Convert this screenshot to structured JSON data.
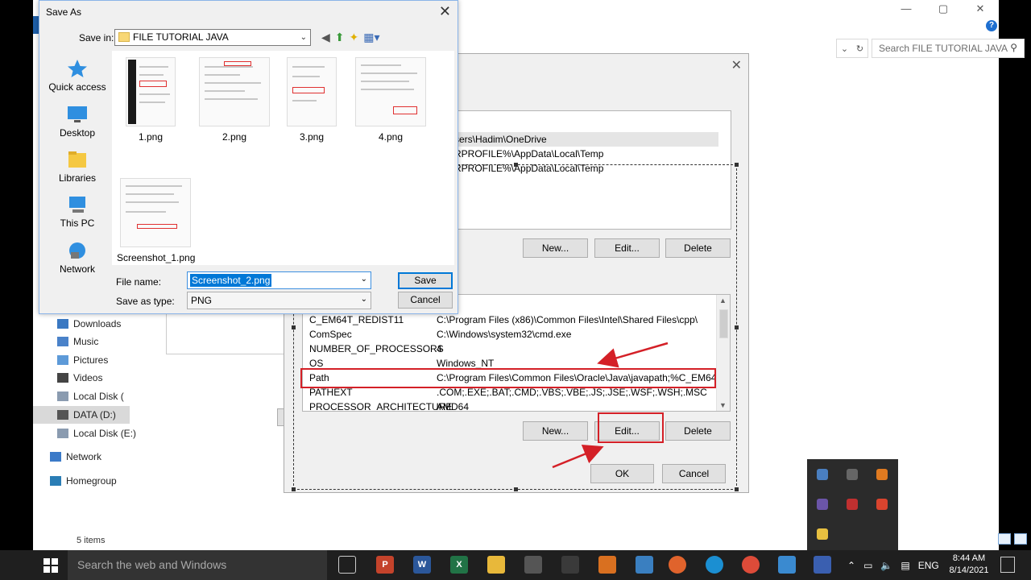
{
  "explorer": {
    "window_controls": [
      "—",
      "▢",
      "✕"
    ],
    "search_placeholder": "Search FILE TUTORIAL JAVA",
    "nav_items": [
      "Downloads",
      "Music",
      "Pictures",
      "Videos",
      "Local Disk (",
      "DATA (D:)",
      "Local Disk (E:)",
      "Network",
      "Homegroup"
    ],
    "status": "5 items",
    "ok_label": "OK"
  },
  "env_dialog": {
    "user_vars": [
      {
        "name": "",
        "value": "sers\\Hadim\\OneDrive"
      },
      {
        "name": "",
        "value": "RPROFILE%\\AppData\\Local\\Temp"
      },
      {
        "name": "",
        "value": "RPROFILE%\\AppData\\Local\\Temp"
      }
    ],
    "user_buttons": {
      "new": "New...",
      "edit": "Edit...",
      "delete": "Delete"
    },
    "system_vars": [
      {
        "name": "C_EM64T_REDIST11",
        "value": "C:\\Program Files (x86)\\Common Files\\Intel\\Shared Files\\cpp\\"
      },
      {
        "name": "ComSpec",
        "value": "C:\\Windows\\system32\\cmd.exe"
      },
      {
        "name": "NUMBER_OF_PROCESSORS",
        "value": "4"
      },
      {
        "name": "OS",
        "value": "Windows_NT"
      },
      {
        "name": "Path",
        "value": "C:\\Program Files\\Common Files\\Oracle\\Java\\javapath;%C_EM64T_..."
      },
      {
        "name": "PATHEXT",
        "value": ".COM;.EXE;.BAT;.CMD;.VBS;.VBE;.JS;.JSE;.WSF;.WSH;.MSC"
      },
      {
        "name": "PROCESSOR_ARCHITECTURE",
        "value": "AMD64"
      }
    ],
    "system_buttons": {
      "new": "New...",
      "edit": "Edit...",
      "delete": "Delete"
    },
    "ok": "OK",
    "cancel": "Cancel"
  },
  "save_as": {
    "title": "Save As",
    "save_in_label": "Save in:",
    "save_in_value": "FILE TUTORIAL JAVA",
    "places": [
      "Quick access",
      "Desktop",
      "Libraries",
      "This PC",
      "Network"
    ],
    "files": [
      "1.png",
      "2.png",
      "3.png",
      "4.png",
      "Screenshot_1.png"
    ],
    "file_name_label": "File name:",
    "file_name_value": "Screenshot_2.png",
    "save_type_label": "Save as type:",
    "save_type_value": "PNG",
    "save_button": "Save",
    "cancel_button": "Cancel"
  },
  "taskbar": {
    "search_placeholder": "Search the web and Windows",
    "lang": "ENG",
    "time": "8:44 AM",
    "date": "8/14/2021"
  }
}
